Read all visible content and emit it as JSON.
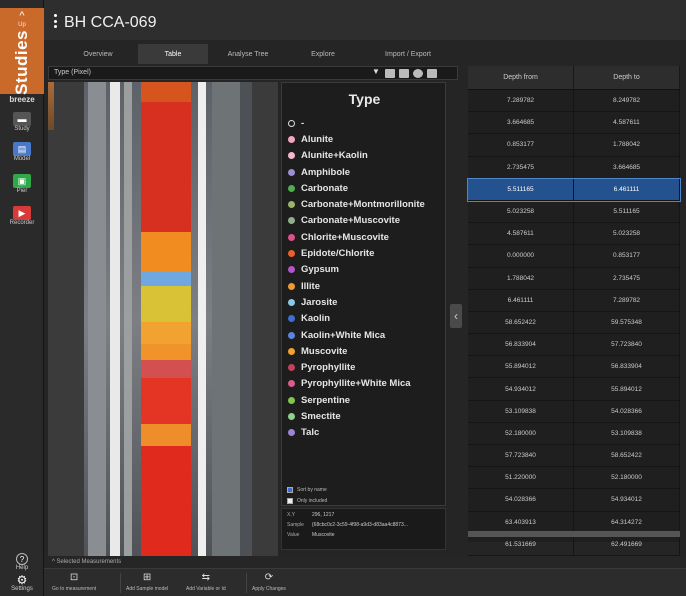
{
  "sidebar": {
    "up_glyph": "^",
    "up_label": "Up",
    "studies_label": "Studies",
    "brand": "breeze",
    "study_label": "Study",
    "model_label": "Model",
    "pier_label": "Pier",
    "recorder_label": "Recorder",
    "help_label": "Help",
    "settings_label": "Settings"
  },
  "header": {
    "title": "BH CCA-069"
  },
  "tabs": [
    {
      "label": "Overview"
    },
    {
      "label": "Table"
    },
    {
      "label": "Analyse Tree"
    },
    {
      "label": "Explore"
    },
    {
      "label": "Import / Export"
    }
  ],
  "selector": {
    "value": "Type (Pixel)",
    "arrow": "▼"
  },
  "legend": {
    "title": "Type",
    "items": [
      {
        "label": "-",
        "color": "#111111"
      },
      {
        "label": "Alunite",
        "color": "#f4a6c0"
      },
      {
        "label": "Alunite+Kaolin",
        "color": "#f2b8d0"
      },
      {
        "label": "Amphibole",
        "color": "#9e8cd4"
      },
      {
        "label": "Carbonate",
        "color": "#4caf50"
      },
      {
        "label": "Carbonate+Montmorillonite",
        "color": "#9bb567"
      },
      {
        "label": "Carbonate+Muscovite",
        "color": "#8fb08a"
      },
      {
        "label": "Chlorite+Muscovite",
        "color": "#d9538a"
      },
      {
        "label": "Epidote/Chlorite",
        "color": "#e8602c"
      },
      {
        "label": "Gypsum",
        "color": "#b455c9"
      },
      {
        "label": "Illite",
        "color": "#f39a2b"
      },
      {
        "label": "Jarosite",
        "color": "#87c9e8"
      },
      {
        "label": "Kaolin",
        "color": "#3b6fd6"
      },
      {
        "label": "Kaolin+White Mica",
        "color": "#5b86db"
      },
      {
        "label": "Muscovite",
        "color": "#f2a230"
      },
      {
        "label": "Pyrophyllite",
        "color": "#c2425c"
      },
      {
        "label": "Pyrophyllite+White Mica",
        "color": "#d95d8a"
      },
      {
        "label": "Serpentine",
        "color": "#7ec84a"
      },
      {
        "label": "Smectite",
        "color": "#8fd08f"
      },
      {
        "label": "Talc",
        "color": "#9b86d6"
      }
    ],
    "sort_label": "Sort by name",
    "only_included_label": "Only included"
  },
  "info": {
    "xy_key": "X,Y",
    "xy_value": "296, 1217",
    "sample_key": "Sample",
    "sample_value": "{68cbc0c2-3c59-4f98-a9d3-d83aa4c8873...",
    "value_key": "Value",
    "value_value": "Muscovite"
  },
  "collapse_glyph": "‹",
  "table": {
    "columns": [
      "Depth from",
      "Depth to"
    ],
    "selected_index": 4,
    "rows": [
      [
        "7.289782",
        "8.249782"
      ],
      [
        "3.664685",
        "4.587611"
      ],
      [
        "0.853177",
        "1.788042"
      ],
      [
        "2.735475",
        "3.664685"
      ],
      [
        "5.511165",
        "6.461111"
      ],
      [
        "5.023258",
        "5.511165"
      ],
      [
        "4.587611",
        "5.023258"
      ],
      [
        "0.000000",
        "0.853177"
      ],
      [
        "1.788042",
        "2.735475"
      ],
      [
        "6.461111",
        "7.289782"
      ],
      [
        "58.652422",
        "59.575348"
      ],
      [
        "56.833904",
        "57.723840"
      ],
      [
        "55.894012",
        "56.833904"
      ],
      [
        "54.934012",
        "55.894012"
      ],
      [
        "53.109838",
        "54.028366"
      ],
      [
        "52.180000",
        "53.109838"
      ],
      [
        "57.723840",
        "58.652422"
      ],
      [
        "51.220000",
        "52.180000"
      ],
      [
        "54.028366",
        "54.934012"
      ],
      [
        "63.403913",
        "64.314272"
      ],
      [
        "61.531669",
        "62.491669"
      ]
    ]
  },
  "selected_measurements": "^  Selected Measurements",
  "bottombar": {
    "goto": "Go to measurement",
    "add_sample": "Add Sample model",
    "add_variable": "Add Variable or Id",
    "apply": "Apply Changes"
  }
}
